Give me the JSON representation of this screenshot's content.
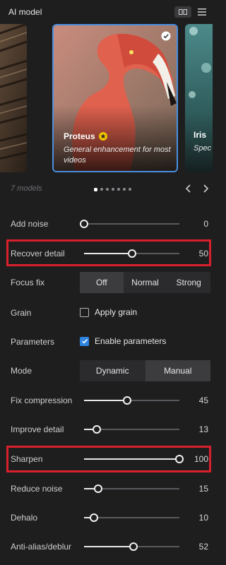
{
  "header": {
    "title": "AI model",
    "view_icon": "grid-view-icon",
    "menu_icon": "hamburger-menu-icon"
  },
  "models": {
    "count_label": "7 models",
    "page_count": 7,
    "active_page": 1,
    "cards": [
      {
        "name": "",
        "description": ""
      },
      {
        "name": "Proteus",
        "description": "General enhancement for most videos",
        "selected": true,
        "badge_icon": "star-badge-icon",
        "badge_color": "#f2c400"
      },
      {
        "name": "Iris",
        "description": "Spec face."
      }
    ]
  },
  "settings": {
    "add_noise": {
      "label": "Add noise",
      "value": "0",
      "fraction": 0.0
    },
    "recover_detail": {
      "label": "Recover detail",
      "value": "50",
      "fraction": 0.5
    },
    "focus_fix": {
      "label": "Focus fix",
      "options": [
        "Off",
        "Normal",
        "Strong"
      ],
      "selected": "Off"
    },
    "grain": {
      "label": "Grain",
      "checkbox_label": "Apply grain",
      "checked": false
    },
    "parameters": {
      "label": "Parameters",
      "checkbox_label": "Enable parameters",
      "checked": true
    },
    "mode": {
      "label": "Mode",
      "options": [
        "Dynamic",
        "Manual"
      ],
      "selected": "Manual"
    },
    "fix_compression": {
      "label": "Fix compression",
      "value": "45",
      "fraction": 0.45
    },
    "improve_detail": {
      "label": "Improve detail",
      "value": "13",
      "fraction": 0.13
    },
    "sharpen": {
      "label": "Sharpen",
      "value": "100",
      "fraction": 1.0
    },
    "reduce_noise": {
      "label": "Reduce noise",
      "value": "15",
      "fraction": 0.15
    },
    "dehalo": {
      "label": "Dehalo",
      "value": "10",
      "fraction": 0.1
    },
    "anti_alias": {
      "label": "Anti-alias/deblur",
      "value": "52",
      "fraction": 0.52
    }
  },
  "colors": {
    "accent": "#2f84e0",
    "highlight": "#d8202c",
    "selection": "#4a8fe0"
  }
}
